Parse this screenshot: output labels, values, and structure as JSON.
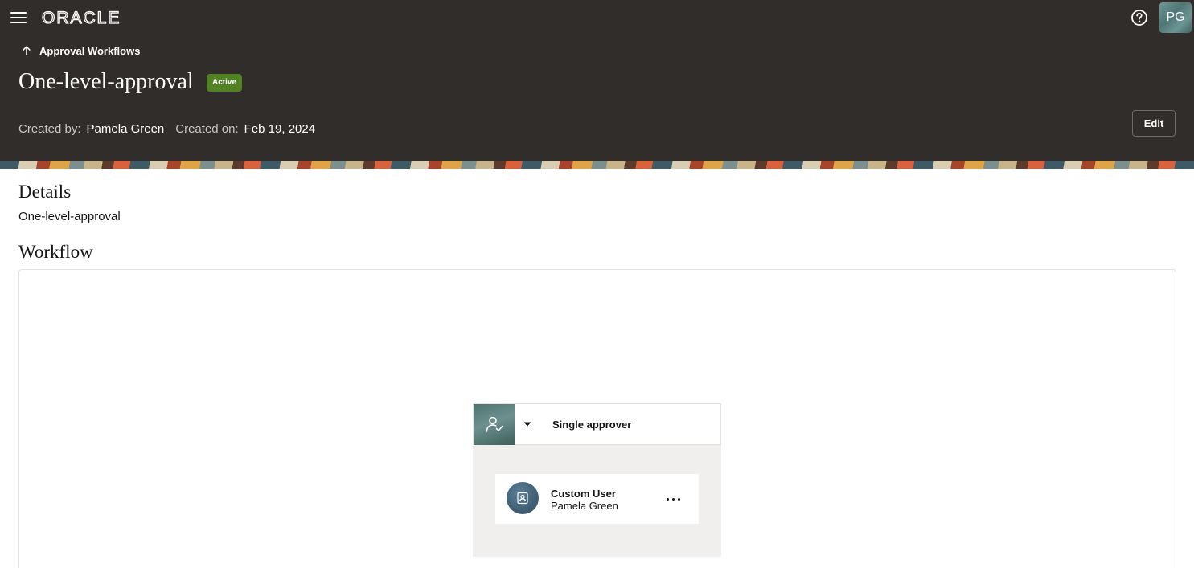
{
  "header": {
    "logo_text": "ORACLE",
    "user_initials": "PG"
  },
  "breadcrumb": {
    "label": "Approval Workflows"
  },
  "page": {
    "title": "One-level-approval",
    "status": "Active",
    "created_by_label": "Created by:",
    "created_by": "Pamela Green",
    "created_on_label": "Created on:",
    "created_on": "Feb 19, 2024",
    "edit_label": "Edit"
  },
  "details": {
    "heading": "Details",
    "text": "One-level-approval"
  },
  "workflow": {
    "heading": "Workflow",
    "stage": {
      "title": "Single approver",
      "icon": "user-check-icon",
      "approver": {
        "type": "Custom User",
        "name": "Pamela Green",
        "icon": "user-badge-icon"
      }
    }
  },
  "colors": {
    "header_bg": "#312d2a",
    "status_green": "#508223",
    "stage_bg": "#f0efed"
  }
}
